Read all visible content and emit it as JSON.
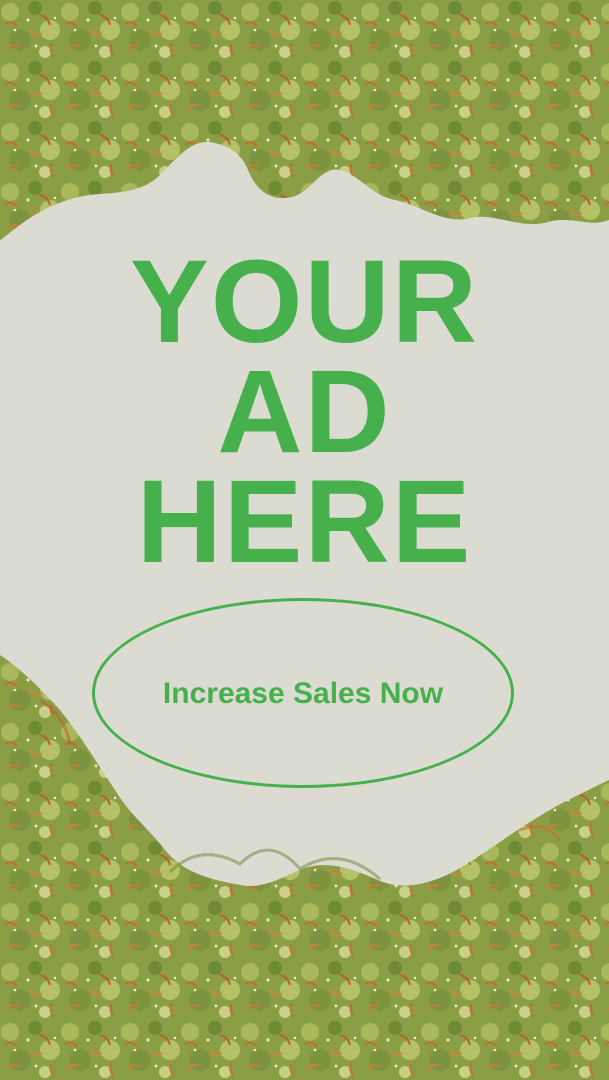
{
  "headline": {
    "line1": "YOUR",
    "line2": "AD",
    "line3": "HERE"
  },
  "cta": {
    "label": "Increase Sales Now"
  },
  "colors": {
    "background": "#dcdbd2",
    "accent_green": "#45b04c",
    "bud_green": "#8fa24a",
    "bud_orange": "#c67a3c"
  }
}
